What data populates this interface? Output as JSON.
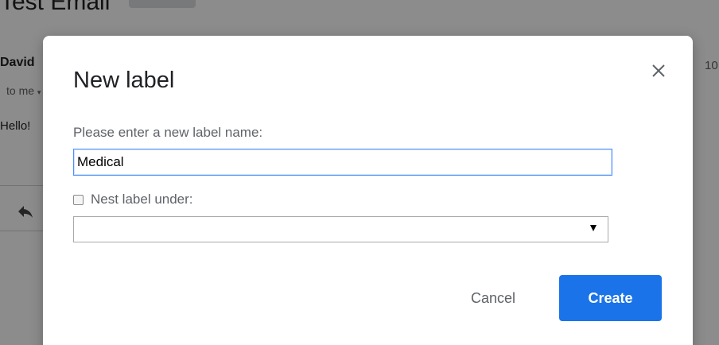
{
  "background": {
    "subject": "Test Email",
    "sender": "David",
    "recipient": "to me",
    "body": "Hello!",
    "time": "10"
  },
  "dialog": {
    "title": "New label",
    "prompt": "Please enter a new label name:",
    "name_value": "Medical",
    "nest_label": "Nest label under:",
    "nest_checked": false,
    "parent_selected": "",
    "cancel_label": "Cancel",
    "create_label": "Create"
  },
  "colors": {
    "primary": "#1a73e8",
    "input_focus": "#4d90fe",
    "muted_text": "#5f6368"
  },
  "icons": {
    "close": "close-icon",
    "reply": "reply-icon",
    "dropdown": "chevron-down-icon"
  }
}
